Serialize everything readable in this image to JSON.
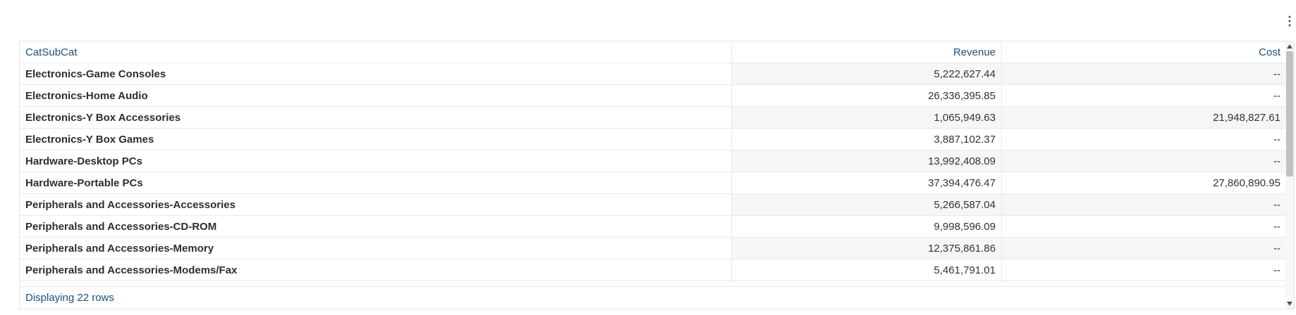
{
  "menu": {
    "icon": "more-vertical-icon"
  },
  "table": {
    "columns": [
      "CatSubCat",
      "Revenue",
      "Cost"
    ],
    "rows": [
      [
        "Electronics-Game Consoles",
        "5,222,627.44",
        "--"
      ],
      [
        "Electronics-Home Audio",
        "26,336,395.85",
        "--"
      ],
      [
        "Electronics-Y Box Accessories",
        "1,065,949.63",
        "21,948,827.61"
      ],
      [
        "Electronics-Y Box Games",
        "3,887,102.37",
        "--"
      ],
      [
        "Hardware-Desktop PCs",
        "13,992,408.09",
        "--"
      ],
      [
        "Hardware-Portable PCs",
        "37,394,476.47",
        "27,860,890.95"
      ],
      [
        "Peripherals and Accessories-Accessories",
        "5,266,587.04",
        "--"
      ],
      [
        "Peripherals and Accessories-CD-ROM",
        "9,998,596.09",
        "--"
      ],
      [
        "Peripherals and Accessories-Memory",
        "12,375,861.86",
        "--"
      ],
      [
        "Peripherals and Accessories-Modems/Fax",
        "5,461,791.01",
        "--"
      ]
    ],
    "footer": "Displaying 22 rows"
  },
  "colors": {
    "header_text": "#1f4f7a",
    "stripe": "#f5f6f7",
    "border": "#e7e9ec"
  }
}
